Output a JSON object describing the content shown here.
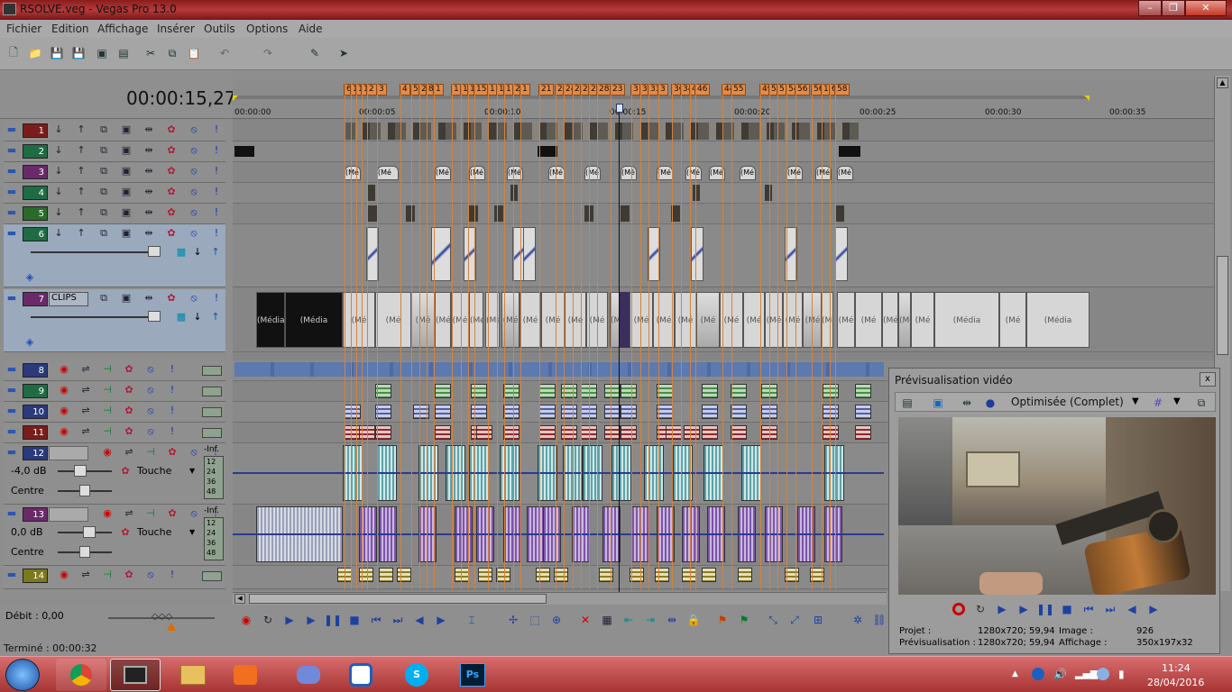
{
  "window": {
    "title": "RSOLVE.veg - Vegas Pro 13.0",
    "min": "–",
    "max": "❐",
    "close": "✕"
  },
  "menu": [
    "Fichier",
    "Edition",
    "Affichage",
    "Insérer",
    "Outils",
    "Options",
    "Aide"
  ],
  "timecode": "00:00:15,27",
  "ruler": {
    "ticks": [
      "00:00:00",
      "00:00:05",
      "00:00:10",
      "00:00:15",
      "00:00:20",
      "00:00:25",
      "00:00:30",
      "00:00:35"
    ]
  },
  "markers": [
    "6",
    "1",
    "1",
    "1",
    "2",
    "3",
    "4",
    "5",
    "2",
    "8",
    "1",
    "1",
    "1",
    "13",
    "15",
    "1",
    "17",
    "1",
    "20",
    "1",
    "21",
    "22",
    "24",
    "25",
    "26",
    "27",
    "28",
    "23",
    "3",
    "32",
    "33",
    "3",
    "36",
    "34",
    "41",
    "46",
    "44",
    "55",
    "49",
    "55",
    "5",
    "54",
    "56",
    "56",
    "1",
    "6",
    "58"
  ],
  "tracks": {
    "video": [
      {
        "n": "1"
      },
      {
        "n": "2"
      },
      {
        "n": "3"
      },
      {
        "n": "4"
      },
      {
        "n": "5"
      },
      {
        "n": "6"
      },
      {
        "n": "7",
        "name": "CLIPS"
      }
    ],
    "audio": [
      {
        "n": "8"
      },
      {
        "n": "9"
      },
      {
        "n": "10"
      },
      {
        "n": "11"
      },
      {
        "n": "12",
        "vol": "-4,0 dB",
        "pan": "Centre",
        "mode": "Touche",
        "inf": "-Inf."
      },
      {
        "n": "13",
        "vol": "0,0 dB",
        "pan": "Centre",
        "mode": "Touche",
        "inf": "-Inf."
      },
      {
        "n": "14"
      }
    ]
  },
  "meter_labels": [
    "12",
    "24",
    "36",
    "48"
  ],
  "clip_labels": {
    "media": "(Média déconnecté)",
    "media_short": "(Média de",
    "short": "(Mé"
  },
  "footer": {
    "rate": "Débit : 0,00",
    "status": "Terminé : 00:00:32"
  },
  "preview": {
    "title": "Prévisualisation vidéo",
    "close": "x",
    "quality": "Optimisée (Complet)",
    "projet_label": "Projet :",
    "projet_val": "1280x720; 59,94",
    "prev_label": "Prévisualisation :",
    "prev_val": "1280x720; 59,94",
    "image_label": "Image :",
    "image_val": "926",
    "affichage_label": "Affichage :",
    "affichage_val": "350x197x32"
  },
  "taskbar": {
    "apps": [
      "Chrome",
      "Vegas",
      "Explorer",
      "Media",
      "Discord",
      "Update",
      "Skype",
      "Ps"
    ],
    "time": "11:24",
    "date": "28/04/2016"
  },
  "colors": {
    "video_track": "#7a1c1c",
    "video_track2": "#1f6b44",
    "audio_accent": "#4a4a9a",
    "marker": "#e38b4a"
  }
}
